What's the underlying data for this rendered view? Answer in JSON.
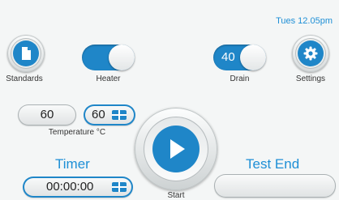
{
  "status": {
    "clock": "Tues 12.05pm"
  },
  "buttons": {
    "standards": {
      "label": "Standards",
      "icon": "document-icon"
    },
    "settings": {
      "label": "Settings",
      "icon": "gear-icon"
    },
    "start": {
      "label": "Start",
      "icon": "play-icon"
    }
  },
  "toggles": {
    "heater": {
      "label": "Heater",
      "on": true
    },
    "drain": {
      "label": "Drain",
      "value": "40",
      "on": true
    }
  },
  "temperature": {
    "current": "60",
    "setpoint": "60",
    "label": "Temperature °C"
  },
  "timer": {
    "title": "Timer",
    "value": "00:00:00"
  },
  "test_end": {
    "title": "Test End",
    "value": ""
  },
  "colors": {
    "accent": "#1f86c8",
    "background": "#f4f6f6"
  }
}
